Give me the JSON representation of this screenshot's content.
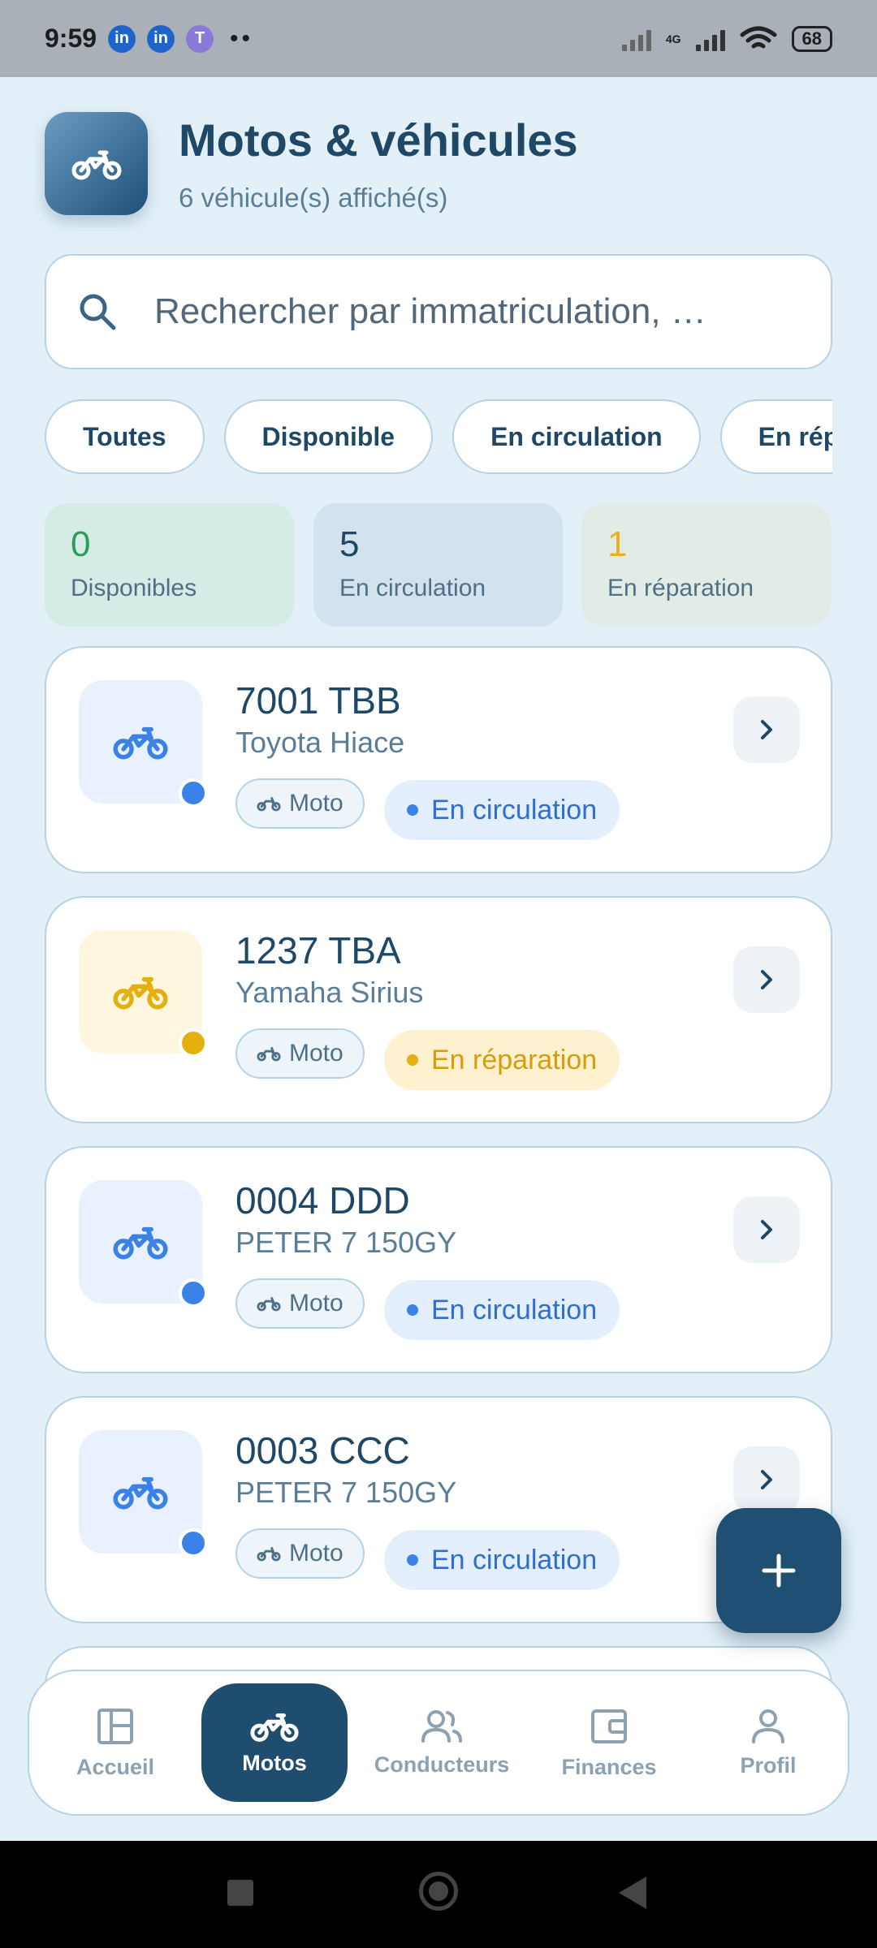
{
  "status_bar": {
    "time": "9:59",
    "network": "4G",
    "battery": "68",
    "notification_icons": [
      "linkedin-icon",
      "linkedin-icon",
      "teams-icon"
    ]
  },
  "header": {
    "title": "Motos & véhicules",
    "subtitle": "6 véhicule(s) affiché(s)"
  },
  "search": {
    "placeholder": "Rechercher par immatriculation, …",
    "value": ""
  },
  "filters": {
    "chips": [
      "Toutes",
      "Disponible",
      "En circulation",
      "En rép"
    ]
  },
  "stats": [
    {
      "value": "0",
      "label": "Disponibles",
      "color": "#2e9d5a"
    },
    {
      "value": "5",
      "label": "En circulation",
      "color": "#1f4766"
    },
    {
      "value": "1",
      "label": "En réparation",
      "color": "#e6b21c"
    }
  ],
  "vehicles": [
    {
      "plate": "7001 TBB",
      "model": "Toyota Hiace",
      "type": "Moto",
      "status": "En circulation",
      "status_color": "#3b82e8"
    },
    {
      "plate": "1237 TBA",
      "model": "Yamaha Sirius",
      "type": "Moto",
      "status": "En réparation",
      "status_color": "#e4b00f"
    },
    {
      "plate": "0004 DDD",
      "model": "PETER 7 150GY",
      "type": "Moto",
      "status": "En circulation",
      "status_color": "#3b82e8"
    },
    {
      "plate": "0003 CCC",
      "model": "PETER 7 150GY",
      "type": "Moto",
      "status": "En circulation",
      "status_color": "#3b82e8"
    }
  ],
  "bottom_nav": {
    "items": [
      {
        "label": "Accueil",
        "icon": "dashboard-icon"
      },
      {
        "label": "Motos",
        "icon": "motorcycle-icon",
        "active": true
      },
      {
        "label": "Conducteurs",
        "icon": "users-icon"
      },
      {
        "label": "Finances",
        "icon": "wallet-icon"
      },
      {
        "label": "Profil",
        "icon": "user-icon"
      }
    ]
  },
  "colors": {
    "primary": "#1f4d6e",
    "accent_blue": "#3b82e8",
    "accent_yellow": "#e4b00f",
    "accent_green": "#2e9d5a",
    "background": "#e3f0f8"
  }
}
